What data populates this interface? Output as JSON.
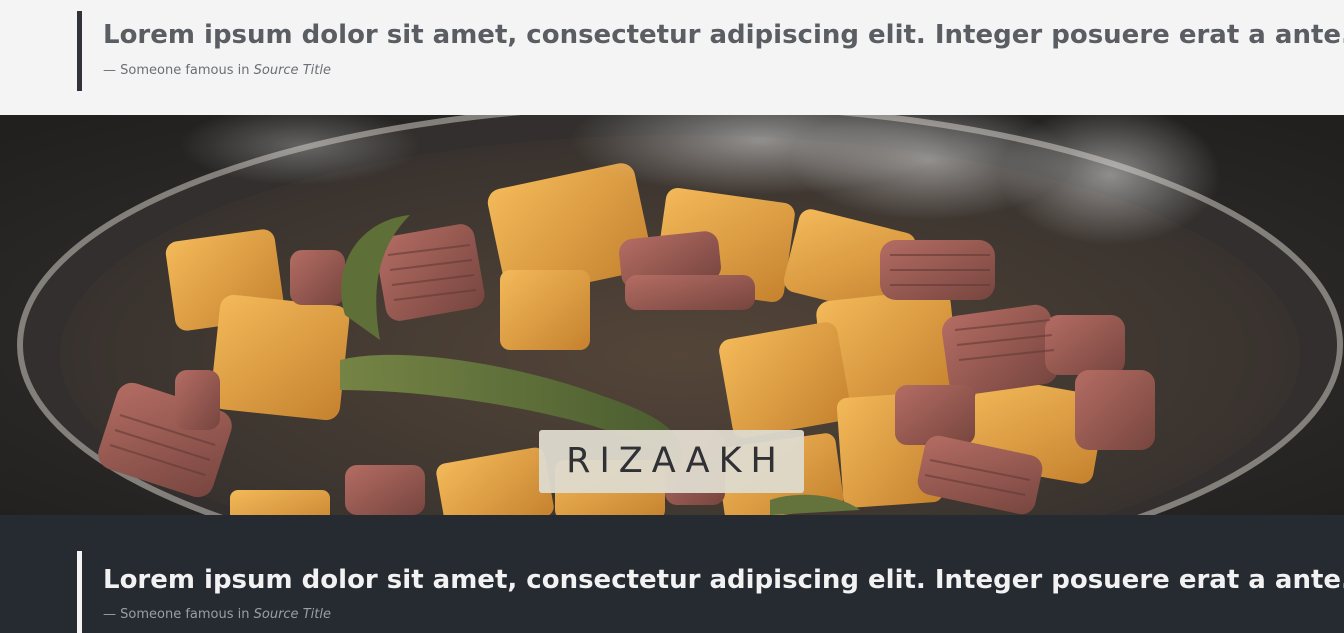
{
  "top_quote": {
    "text": "Lorem ipsum dolor sit amet, consectetur adipiscing elit. Integer posuere erat a ante.",
    "footer_prefix": "— Someone famous in ",
    "source_title": "Source Title"
  },
  "hero": {
    "brand_name": "RIZAAKH",
    "image_subject": "sizzling vegetables and sausage slices in a frying pan"
  },
  "bottom_quote": {
    "text": "Lorem ipsum dolor sit amet, consectetur adipiscing elit. Integer posuere erat a ante.",
    "footer_prefix": "— Someone famous in ",
    "source_title": "Source Title"
  },
  "colors": {
    "light_bg": "#f4f4f4",
    "dark_bg": "#262a31",
    "brand_badge_bg": "#dedace",
    "quote_text_light": "#5a5d61",
    "quote_text_dark": "#f2f2f2"
  }
}
